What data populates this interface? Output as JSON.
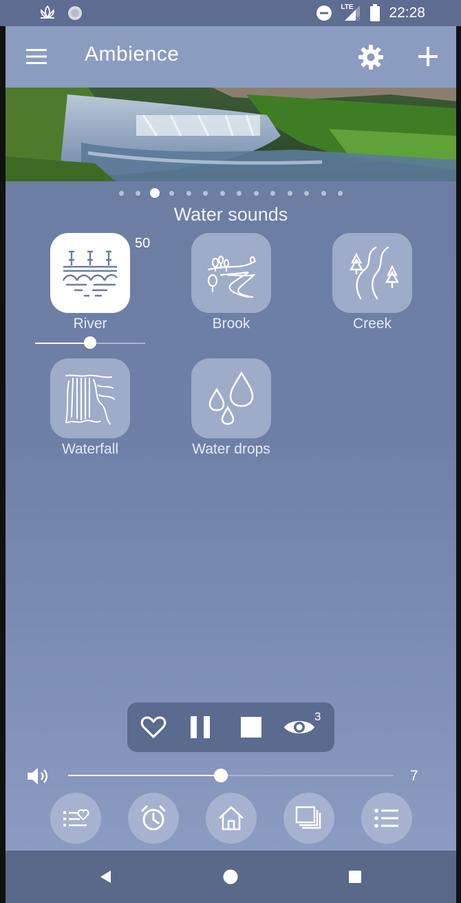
{
  "status_bar": {
    "time": "22:28",
    "network_label": "LTE",
    "left_icons": [
      "lotus-icon",
      "circle-app-icon"
    ],
    "right_icons": [
      "do-not-disturb-icon",
      "lte-signal-icon",
      "battery-icon"
    ]
  },
  "app_bar": {
    "title": "Ambience",
    "menu_icon": "hamburger-menu-icon",
    "settings_icon": "gear-icon",
    "add_icon": "plus-icon"
  },
  "carousel": {
    "page_count": 14,
    "active_index": 2
  },
  "section": {
    "title": "Water sounds"
  },
  "sounds": [
    {
      "label": "River",
      "icon": "river-bridge-icon",
      "active": true,
      "volume_label": "50",
      "volume": 0.5
    },
    {
      "label": "Brook",
      "icon": "brook-icon",
      "active": false
    },
    {
      "label": "Creek",
      "icon": "creek-icon",
      "active": false
    },
    {
      "label": "Waterfall",
      "icon": "waterfall-icon",
      "active": false
    },
    {
      "label": "Water drops",
      "icon": "water-drops-icon",
      "active": false
    }
  ],
  "player": {
    "favorite_icon": "heart-icon",
    "pause_icon": "pause-icon",
    "stop_icon": "stop-icon",
    "view_icon": "eye-icon",
    "view_badge": "3"
  },
  "volume": {
    "icon": "speaker-icon",
    "value_label": "7",
    "level": 0.47
  },
  "bottom_nav": [
    {
      "icon": "favorites-list-icon"
    },
    {
      "icon": "alarm-clock-icon"
    },
    {
      "icon": "home-icon"
    },
    {
      "icon": "layers-icon"
    },
    {
      "icon": "list-icon"
    }
  ],
  "system_nav": [
    "back-icon",
    "home-circle-icon",
    "recents-icon"
  ],
  "colors": {
    "app_bar": "#8b9cc1",
    "background": "#6e80a8",
    "tile": "#9eabc9",
    "tile_active": "#ffffff",
    "player_bar": "#5b6a8f"
  }
}
